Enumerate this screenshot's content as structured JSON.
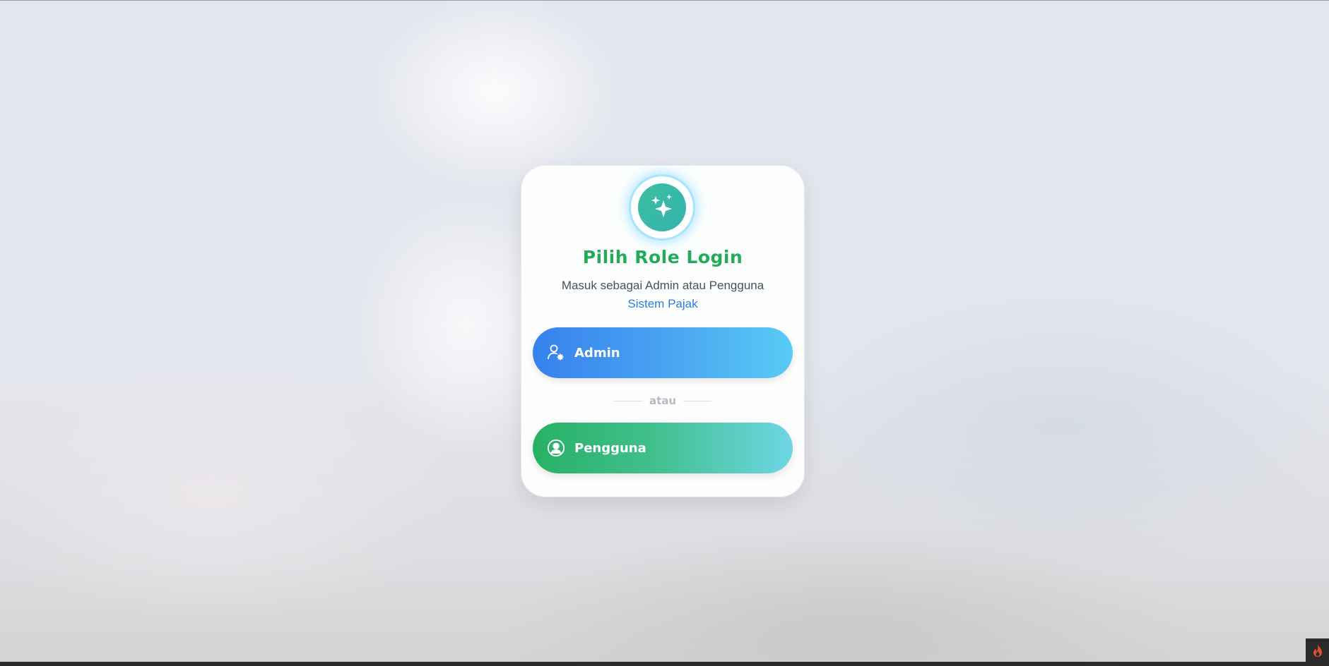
{
  "login": {
    "title": "Pilih Role Login",
    "subtitle": "Masuk sebagai Admin atau Pengguna",
    "subtitle_accent": "Sistem Pajak",
    "divider_text": "atau",
    "admin_label": "Admin",
    "user_label": "Pengguna",
    "logo_icon": "sparkles-icon",
    "admin_icon": "user-gear-icon",
    "user_icon": "user-circle-icon"
  },
  "colors": {
    "title": "#22ac57",
    "accent": "#2f7ae0",
    "admin_gradient_start": "#3681ee",
    "admin_gradient_end": "#58cbf5",
    "user_gradient_start": "#27b165",
    "user_gradient_end": "#6ed6e4"
  },
  "corner_badge_icon": "flame-icon"
}
